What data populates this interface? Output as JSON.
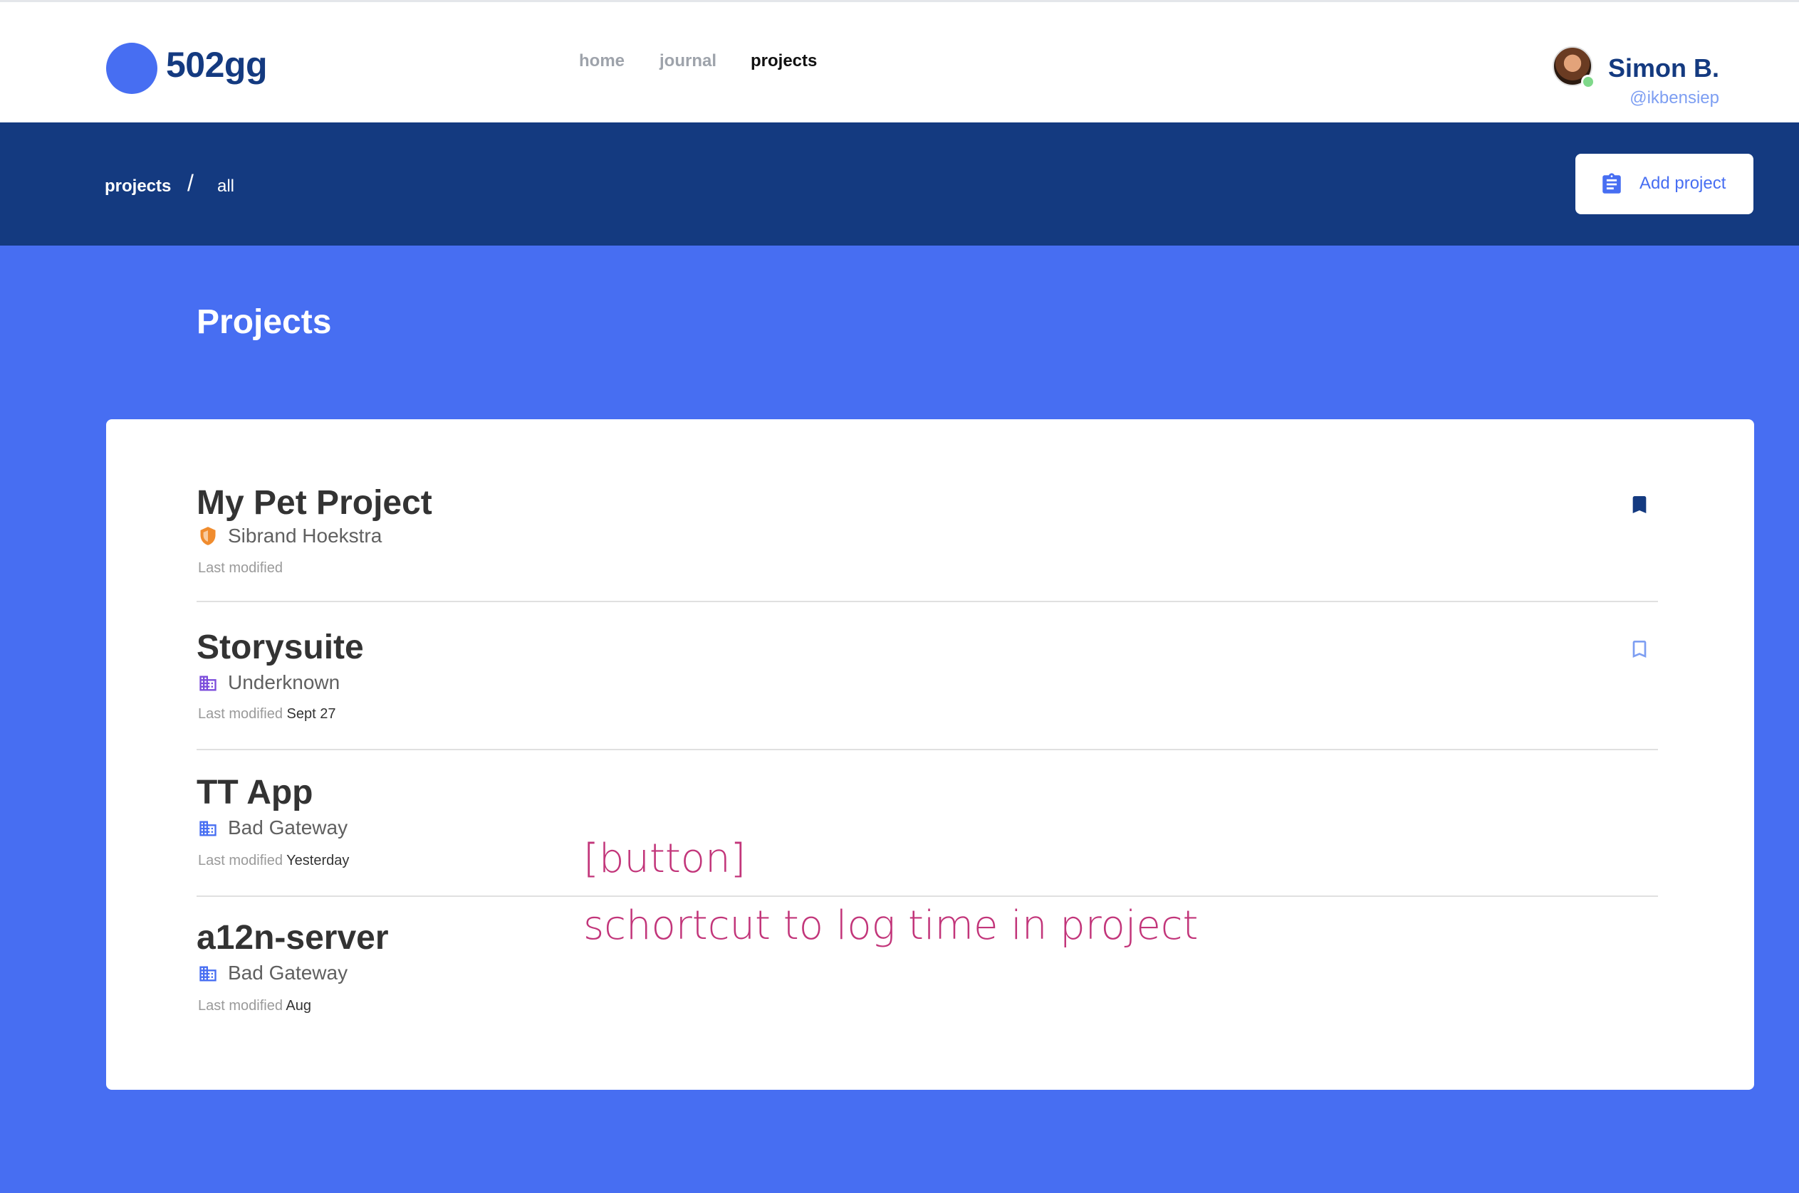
{
  "app": {
    "logo_text": "502gg",
    "brand_color": "#476ef2",
    "dark_color": "#143a80"
  },
  "nav": {
    "items": [
      {
        "label": "home",
        "active": false
      },
      {
        "label": "journal",
        "active": false
      },
      {
        "label": "projects",
        "active": true
      }
    ]
  },
  "user": {
    "name": "Simon B.",
    "handle": "@ikbensiep",
    "status": "online"
  },
  "breadcrumb": {
    "root": "projects",
    "separator": "/",
    "current": "all"
  },
  "actions": {
    "add_project_label": "Add project",
    "add_project_icon": "clipboard-icon"
  },
  "page": {
    "title": "Projects"
  },
  "projects": [
    {
      "title": "My Pet Project",
      "owner": "Sibrand Hoekstra",
      "owner_icon": "shield-icon",
      "owner_icon_color": "#f08c2e",
      "modified_label": "Last modified",
      "modified_value": "",
      "bookmarked": true
    },
    {
      "title": "Storysuite",
      "owner": "Underknown",
      "owner_icon": "building-icon",
      "owner_icon_color": "#7c4ddb",
      "modified_label": "Last modified",
      "modified_value": "Sept 27",
      "bookmarked": false
    },
    {
      "title": "TT App",
      "owner": "Bad Gateway",
      "owner_icon": "building-icon",
      "owner_icon_color": "#476ef2",
      "modified_label": "Last modified",
      "modified_value": "Yesterday",
      "bookmarked": null
    },
    {
      "title": "a12n-server",
      "owner": "Bad Gateway",
      "owner_icon": "building-icon",
      "owner_icon_color": "#476ef2",
      "modified_label": "Last modified",
      "modified_value": "Aug",
      "bookmarked": null
    }
  ],
  "annotations": {
    "button_note": "[button]",
    "shortcut_note": "schortcut to log time in project",
    "color": "#c2357a"
  }
}
